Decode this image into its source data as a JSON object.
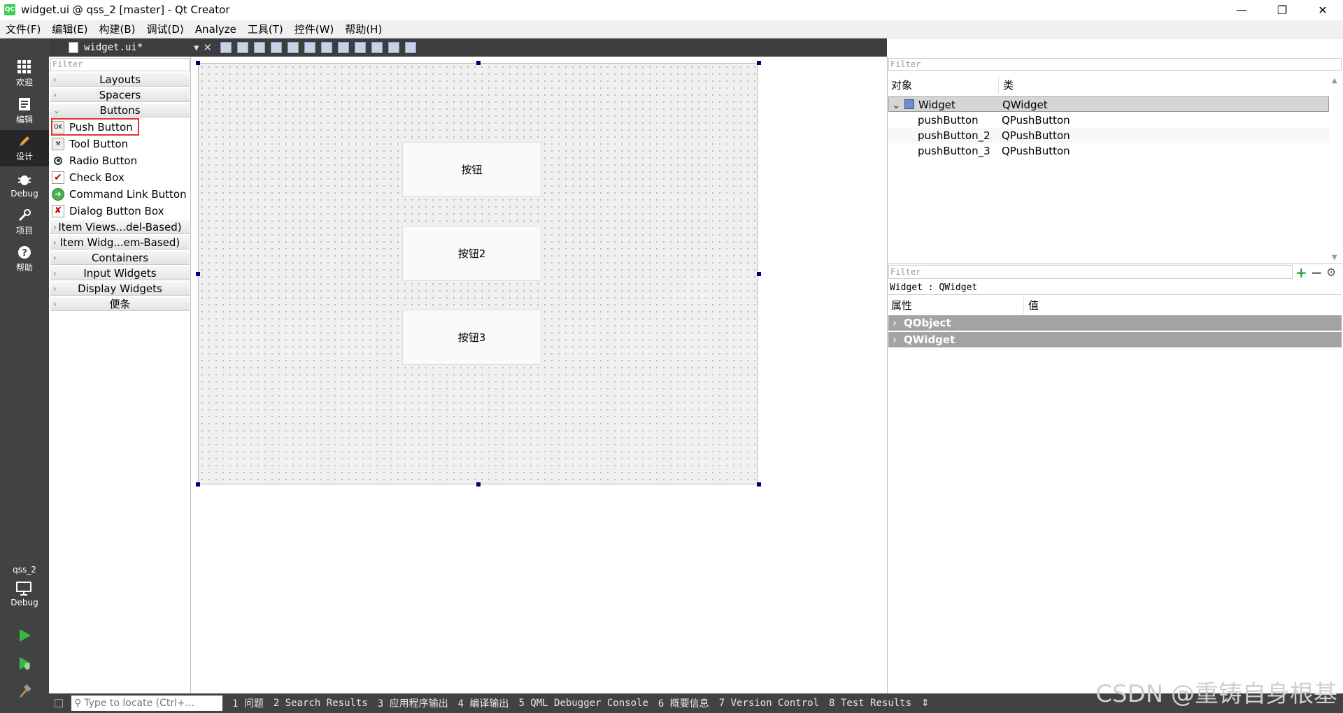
{
  "window": {
    "title": "widget.ui @ qss_2 [master] - Qt Creator",
    "controls": [
      "—",
      "❐",
      "✕"
    ]
  },
  "menubar": [
    "文件(F)",
    "编辑(E)",
    "构建(B)",
    "调试(D)",
    "Analyze",
    "工具(T)",
    "控件(W)",
    "帮助(H)"
  ],
  "modes": [
    {
      "label": "欢迎",
      "icon": "grid-icon"
    },
    {
      "label": "编辑",
      "icon": "edit-doc-icon"
    },
    {
      "label": "设计",
      "icon": "pencil-icon",
      "active": true
    },
    {
      "label": "Debug",
      "icon": "bug-icon"
    },
    {
      "label": "项目",
      "icon": "wrench-icon"
    },
    {
      "label": "帮助",
      "icon": "help-icon"
    }
  ],
  "kit": {
    "project": "qss_2",
    "config": "Debug"
  },
  "document_tab": "widget.ui*",
  "widget_box": {
    "filter_placeholder": "Filter",
    "categories_top": [
      "Layouts",
      "Spacers",
      "Buttons"
    ],
    "button_items": [
      "Push Button",
      "Tool Button",
      "Radio Button",
      "Check Box",
      "Command Link Button",
      "Dialog Button Box"
    ],
    "categories_bottom": [
      "Item Views...del-Based)",
      "Item Widg...em-Based)",
      "Containers",
      "Input Widgets",
      "Display Widgets",
      "便条"
    ]
  },
  "form": {
    "buttons": [
      "按钮",
      "按钮2",
      "按钮3"
    ]
  },
  "object_inspector": {
    "filter_placeholder": "Filter",
    "header_object": "对象",
    "header_class": "类",
    "rows": [
      {
        "object": "Widget",
        "class": "QWidget"
      },
      {
        "object": "pushButton",
        "class": "QPushButton"
      },
      {
        "object": "pushButton_2",
        "class": "QPushButton"
      },
      {
        "object": "pushButton_3",
        "class": "QPushButton"
      }
    ]
  },
  "property_editor": {
    "filter_placeholder": "Filter",
    "title": "Widget : QWidget",
    "header_property": "属性",
    "header_value": "值",
    "groups": [
      "QObject",
      "QWidget"
    ]
  },
  "statusbar": {
    "locator_placeholder": "Type to locate (Ctrl+...",
    "tabs": [
      "1 问题",
      "2 Search Results",
      "3 应用程序输出",
      "4 编译输出",
      "5 QML Debugger Console",
      "6 概要信息",
      "7 Version Control",
      "8 Test Results"
    ]
  },
  "watermark": "CSDN @重铸自身根基",
  "colors": {
    "modebar": "#404244",
    "selection_outline": "#e0342c",
    "handle": "#00007f",
    "run_green": "#3eb543"
  }
}
